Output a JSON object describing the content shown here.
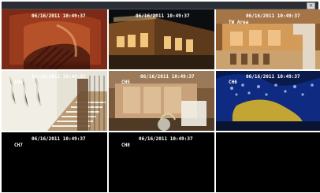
{
  "window": {
    "close_icon": "×"
  },
  "tiles": [
    {
      "timestamp": "06/16/2011 10:49:37",
      "label": ""
    },
    {
      "timestamp": "06/16/2011 10:49:37",
      "label": ""
    },
    {
      "timestamp": "06/16/2011 10:49:37",
      "label": "TW Area"
    },
    {
      "timestamp": "06/16/2011 10:49:37",
      "label": "CH4"
    },
    {
      "timestamp": "06/16/2011 10:49:37",
      "label": "CH5"
    },
    {
      "timestamp": "06/16/2011 10:49:37",
      "label": "CH6"
    },
    {
      "timestamp": "06/16/2011 10:49:37",
      "label": "CH7"
    },
    {
      "timestamp": "06/16/2011 10:49:37",
      "label": "CH8"
    },
    {
      "timestamp": "",
      "label": ""
    }
  ]
}
